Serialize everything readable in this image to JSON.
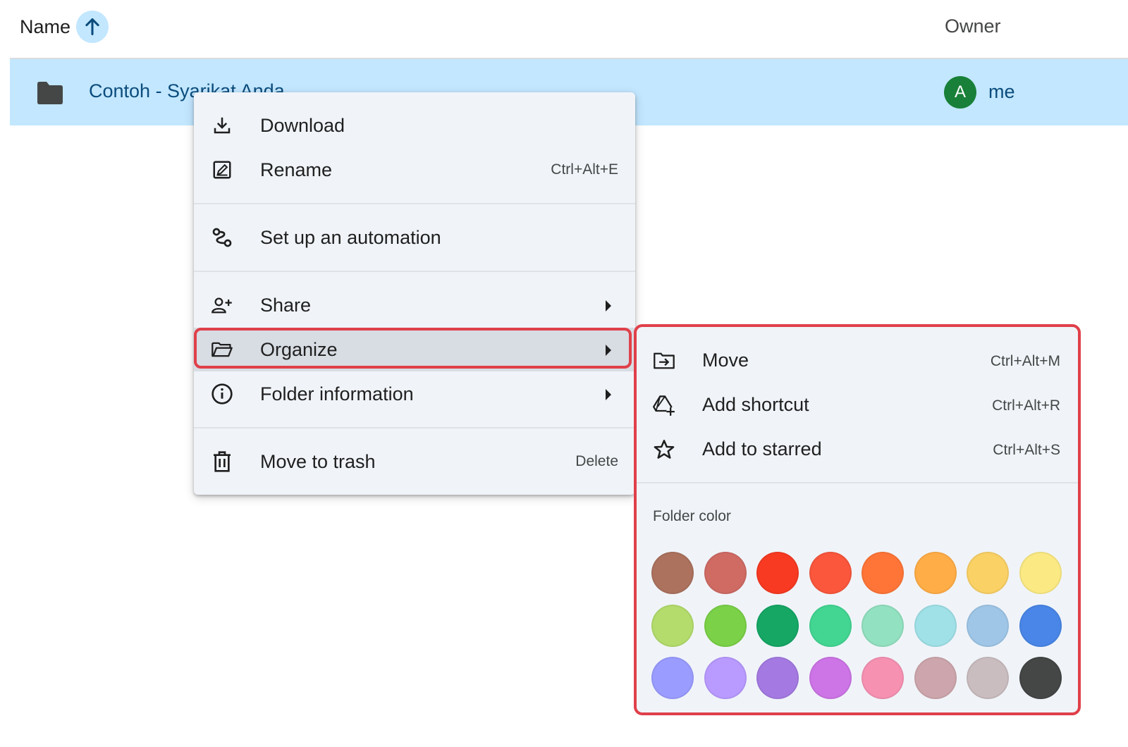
{
  "header": {
    "name_label": "Name",
    "sort_icon": "arrow-up-icon",
    "owner_label": "Owner"
  },
  "row": {
    "name": "Contoh - Syarikat Anda",
    "owner_initial": "A",
    "owner": "me",
    "selected_color": "#c2e7ff"
  },
  "context_menu": {
    "download": {
      "label": "Download",
      "icon": "download-icon"
    },
    "rename": {
      "label": "Rename",
      "shortcut": "Ctrl+Alt+E",
      "icon": "rename-icon"
    },
    "automation": {
      "label": "Set up an automation",
      "icon": "automation-icon"
    },
    "share": {
      "label": "Share",
      "icon": "share-icon"
    },
    "organize": {
      "label": "Organize",
      "icon": "folder-open-icon"
    },
    "info": {
      "label": "Folder information",
      "icon": "info-icon"
    },
    "trash": {
      "label": "Move to trash",
      "shortcut": "Delete",
      "icon": "trash-icon"
    }
  },
  "organize_submenu": {
    "move": {
      "label": "Move",
      "shortcut": "Ctrl+Alt+M",
      "icon": "move-folder-icon"
    },
    "shortcut": {
      "label": "Add shortcut",
      "shortcut": "Ctrl+Alt+R",
      "icon": "add-shortcut-icon"
    },
    "starred": {
      "label": "Add to starred",
      "shortcut": "Ctrl+Alt+S",
      "icon": "star-icon"
    },
    "folder_color_label": "Folder color",
    "colors": [
      "#ac725e",
      "#d06b64",
      "#f83a22",
      "#fa573c",
      "#ff7537",
      "#ffad46",
      "#fad165",
      "#fbe983",
      "#b3dc6c",
      "#7bd148",
      "#16a765",
      "#42d692",
      "#92e1c0",
      "#9fe1e7",
      "#9fc6e7",
      "#4986e7",
      "#9a9cff",
      "#b99aff",
      "#a47ae2",
      "#cd74e6",
      "#f691b2",
      "#cca6ac",
      "#cabdbf",
      "#444746"
    ]
  },
  "highlight_color": "#e0404a"
}
